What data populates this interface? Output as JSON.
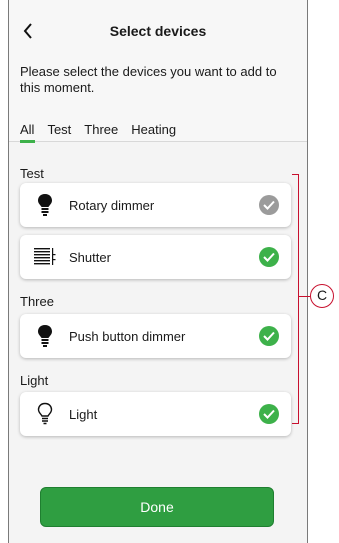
{
  "header": {
    "title": "Select devices",
    "back_icon": "chevron-left-icon"
  },
  "instructions": "Please select the devices you want to add to this moment.",
  "tabs": [
    {
      "label": "All",
      "active": true
    },
    {
      "label": "Test",
      "active": false
    },
    {
      "label": "Three",
      "active": false
    },
    {
      "label": "Heating",
      "active": false
    }
  ],
  "sections": [
    {
      "title": "Test",
      "devices": [
        {
          "label": "Rotary dimmer",
          "icon": "bulb-filled-icon",
          "selected": false
        },
        {
          "label": "Shutter",
          "icon": "shutter-icon",
          "selected": true
        }
      ]
    },
    {
      "title": "Three",
      "devices": [
        {
          "label": "Push button dimmer",
          "icon": "bulb-filled-icon",
          "selected": true
        }
      ]
    },
    {
      "title": "Light",
      "devices": [
        {
          "label": "Light",
          "icon": "bulb-outline-icon",
          "selected": true
        }
      ]
    }
  ],
  "done_label": "Done",
  "callout_label": "C",
  "colors": {
    "accent": "#3db14a",
    "button": "#2f9e41",
    "annotation": "#c8102e",
    "unselected": "#9b9b9b"
  }
}
